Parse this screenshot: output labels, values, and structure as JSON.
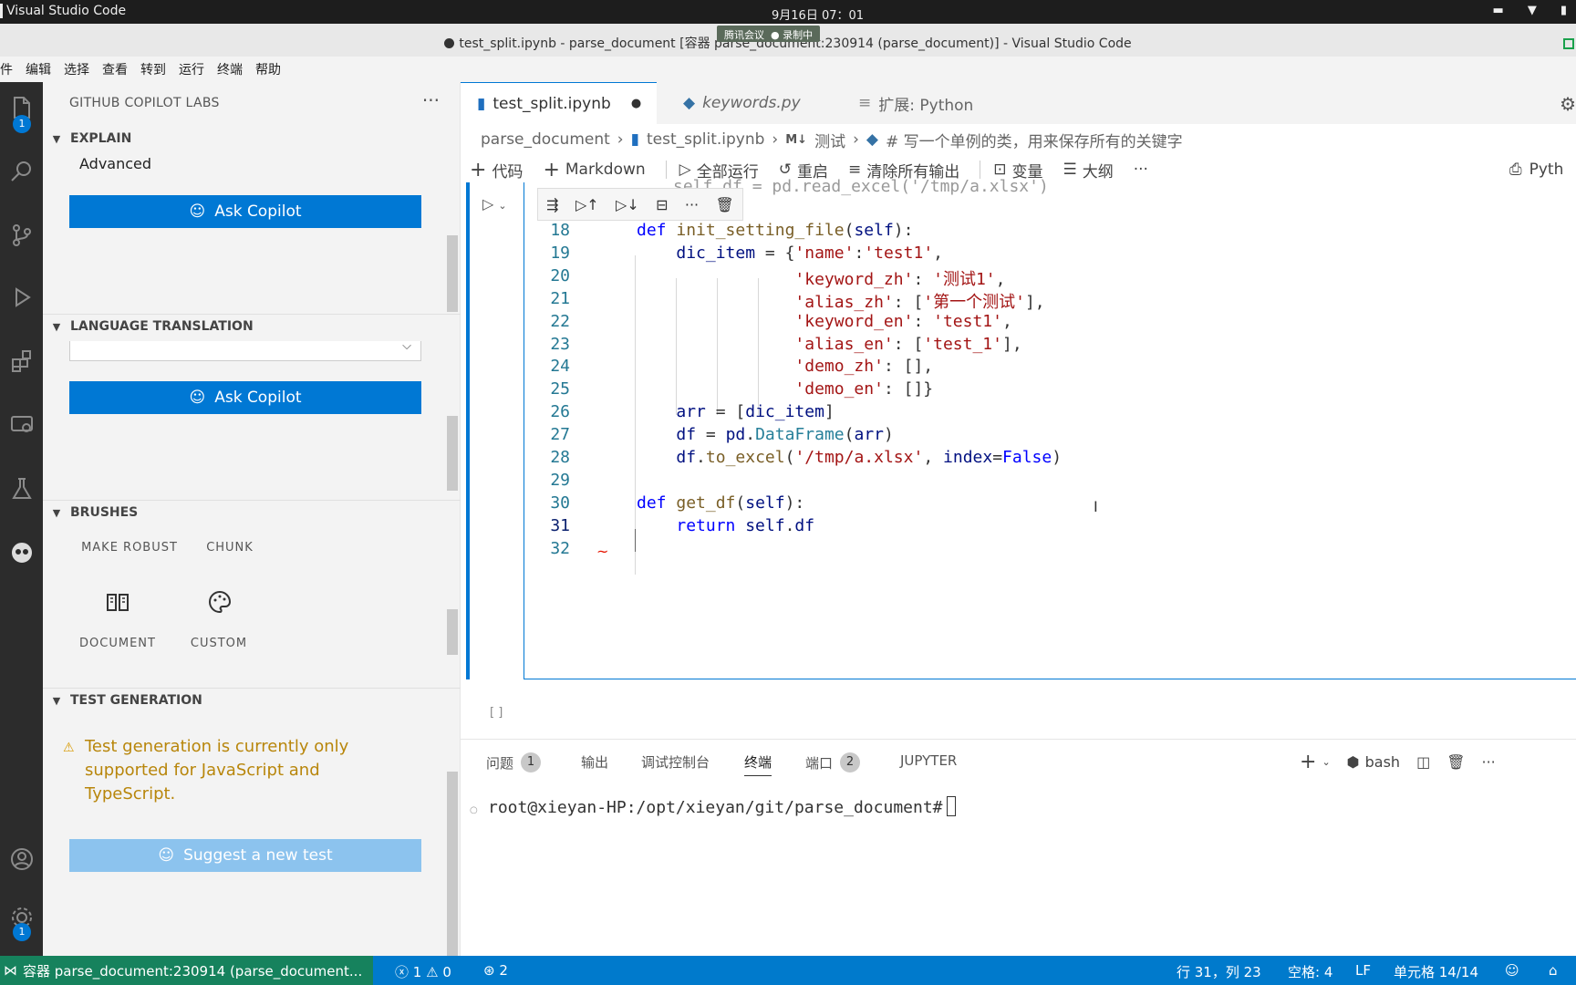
{
  "os": {
    "app_name": "Visual Studio Code",
    "clock": "9月16日 07：01"
  },
  "window": {
    "title": "test_split.ipynb - parse_document [容器 parse_document:230914 (parse_document)] - Visual Studio Code",
    "meeting_label": "腾讯会议",
    "recording_label": "录制中"
  },
  "menu": [
    "件",
    "编辑",
    "选择",
    "查看",
    "转到",
    "运行",
    "终端",
    "帮助"
  ],
  "activity": {
    "explorer_badge": "1",
    "settings_badge": "1"
  },
  "sidebar": {
    "header": "GITHUB COPILOT LABS",
    "explain": {
      "title": "EXPLAIN",
      "value": "Advanced",
      "button": "Ask Copilot"
    },
    "translation": {
      "title": "LANGUAGE TRANSLATION",
      "select_value": "",
      "button": "Ask Copilot"
    },
    "brushes": {
      "title": "BRUSHES",
      "items": [
        "MAKE ROBUST",
        "CHUNK",
        "DOCUMENT",
        "CUSTOM"
      ]
    },
    "test_generation": {
      "title": "TEST GENERATION",
      "warning": "Test generation is currently only supported for JavaScript and TypeScript.",
      "button": "Suggest a new test"
    }
  },
  "editor": {
    "tabs": [
      {
        "label": "test_split.ipynb",
        "dirty": true
      },
      {
        "label": "keywords.py"
      },
      {
        "label": "扩展: Python"
      }
    ],
    "breadcrumb": [
      "parse_document",
      "test_split.ipynb",
      "测试",
      "# 写一个单例的类，用来保存所有的关键字"
    ],
    "breadcrumb_md_label": "M↓",
    "toolbar": [
      "代码",
      "Markdown",
      "全部运行",
      "重启",
      "清除所有输出",
      "变量",
      "大纲"
    ],
    "kernel_label": "Pyth",
    "exec_count": "[ ]",
    "partial_line": "self.df = pd.read_excel('/tmp/a.xlsx')",
    "line_numbers": [
      "18",
      "19",
      "20",
      "21",
      "22",
      "23",
      "24",
      "25",
      "26",
      "27",
      "28",
      "29",
      "30",
      "31",
      "32"
    ]
  },
  "panel": {
    "tabs": [
      {
        "label": "问题",
        "badge": "1"
      },
      {
        "label": "输出"
      },
      {
        "label": "调试控制台"
      },
      {
        "label": "终端"
      },
      {
        "label": "端口",
        "badge": "2"
      },
      {
        "label": "JUPYTER"
      }
    ],
    "shell": "bash",
    "prompt": "root@xieyan-HP:/opt/xieyan/git/parse_document#"
  },
  "status": {
    "remote": "容器 parse_document:230914 (parse_document...",
    "errors": "1",
    "warnings": "0",
    "ports": "2",
    "position": "行 31，列 23",
    "spaces": "空格: 4",
    "eol": "LF",
    "cell": "单元格 14/14"
  },
  "colors": {
    "accent": "#0078d4",
    "status_bar": "#007acc",
    "remote": "#16825d",
    "warning_text": "#b8860b"
  }
}
